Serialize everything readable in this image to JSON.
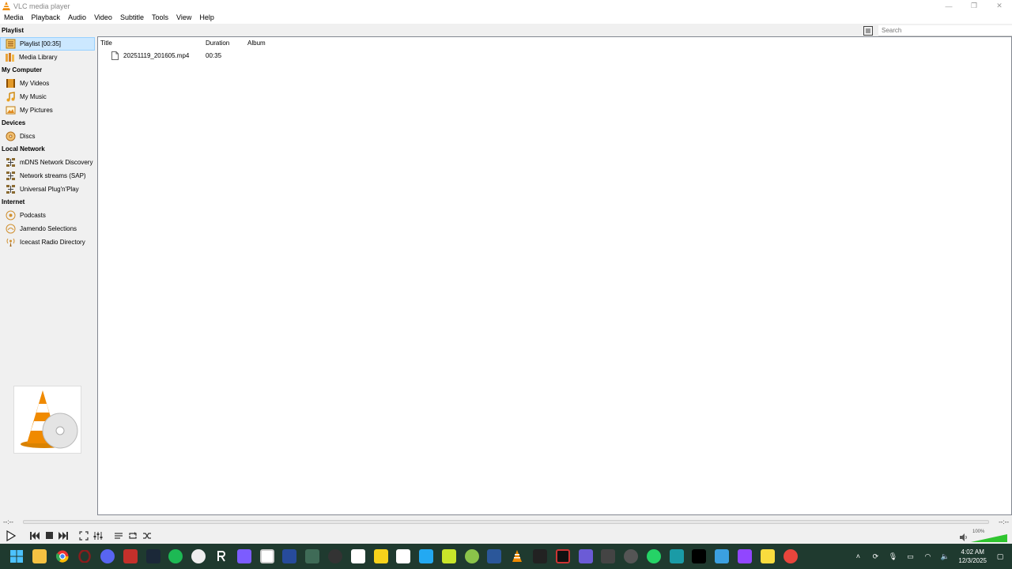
{
  "window": {
    "title": "VLC media player",
    "minimize": "—",
    "maximize": "❐",
    "close": "✕"
  },
  "menubar": [
    "Media",
    "Playback",
    "Audio",
    "Video",
    "Subtitle",
    "Tools",
    "View",
    "Help"
  ],
  "sidebar": {
    "sections": [
      {
        "header": "Playlist",
        "items": [
          {
            "label": "Playlist [00:35]",
            "icon": "playlist-icon",
            "selected": true
          },
          {
            "label": "Media Library",
            "icon": "media-library-icon"
          }
        ]
      },
      {
        "header": "My Computer",
        "items": [
          {
            "label": "My Videos",
            "icon": "video-icon"
          },
          {
            "label": "My Music",
            "icon": "music-note-icon"
          },
          {
            "label": "My Pictures",
            "icon": "picture-icon"
          }
        ]
      },
      {
        "header": "Devices",
        "items": [
          {
            "label": "Discs",
            "icon": "disc-icon"
          }
        ]
      },
      {
        "header": "Local Network",
        "items": [
          {
            "label": "mDNS Network Discovery",
            "icon": "network-icon"
          },
          {
            "label": "Network streams (SAP)",
            "icon": "network-icon"
          },
          {
            "label": "Universal Plug'n'Play",
            "icon": "network-icon"
          }
        ]
      },
      {
        "header": "Internet",
        "items": [
          {
            "label": "Podcasts",
            "icon": "podcast-icon"
          },
          {
            "label": "Jamendo Selections",
            "icon": "jamendo-icon"
          },
          {
            "label": "Icecast Radio Directory",
            "icon": "radio-icon"
          }
        ]
      }
    ]
  },
  "playlist": {
    "columns": [
      "Title",
      "Duration",
      "Album"
    ],
    "rows": [
      {
        "title": "20251119_201605.mp4",
        "duration": "00:35",
        "album": ""
      }
    ]
  },
  "search": {
    "placeholder": "Search"
  },
  "seek": {
    "elapsed": "--:--",
    "total": "--:--"
  },
  "volume": {
    "level": "100%",
    "fraction": 1.0
  },
  "taskbar": {
    "clock_time": "4:02 AM",
    "clock_date": "12/3/2025"
  },
  "colors": {
    "vlc_orange": "#f08a00",
    "selection": "#cce8ff",
    "taskbar": "#1f3a2f"
  }
}
